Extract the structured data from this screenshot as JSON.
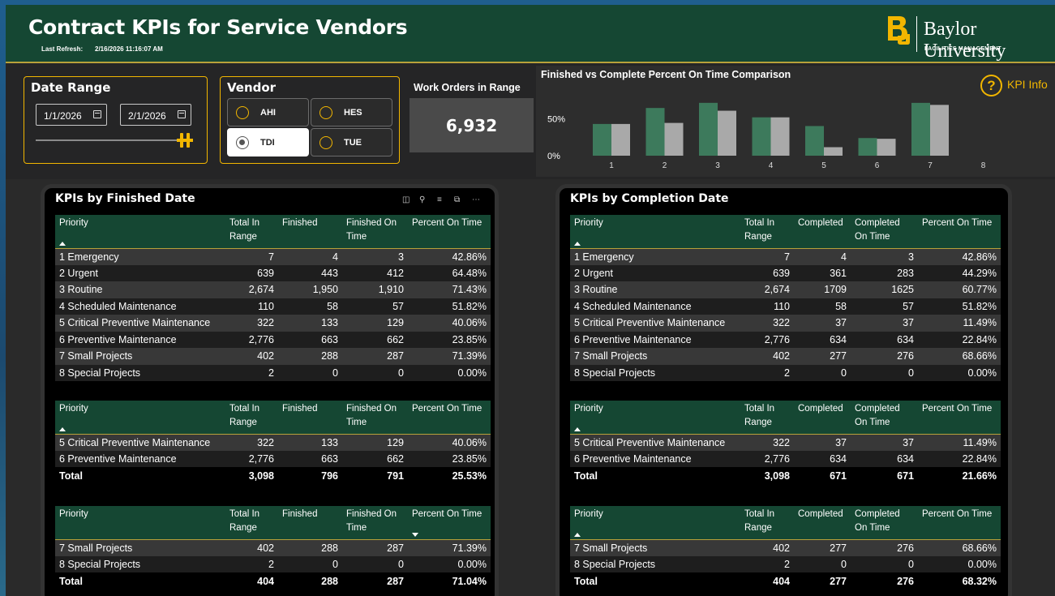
{
  "header": {
    "title": "Contract KPIs for Service Vendors",
    "refresh_label": "Last Refresh:",
    "refresh_value": "2/16/2026 11:16:07 AM",
    "logo_name": "Baylor University",
    "logo_sub": "FACILITIES MANAGEMENT"
  },
  "date_range": {
    "title": "Date Range",
    "start": "1/1/2026",
    "end": "2/1/2026"
  },
  "vendor": {
    "title": "Vendor",
    "options": [
      {
        "label": "AHI",
        "selected": false
      },
      {
        "label": "HES",
        "selected": false
      },
      {
        "label": "TDI",
        "selected": true
      },
      {
        "label": "TUE",
        "selected": false
      }
    ]
  },
  "work_orders": {
    "title": "Work Orders in Range",
    "value": "6,932"
  },
  "kpi_info": {
    "icon": "question-circle-icon",
    "label": "KPI Info"
  },
  "colors": {
    "accent": "#f2b600",
    "brand_green": "#154733",
    "bar_green": "#3d7a5c",
    "bar_gray": "#a9a9a9"
  },
  "chart_data": {
    "type": "bar",
    "title": "Finished vs Complete Percent On Time Comparison",
    "categories": [
      "1",
      "2",
      "3",
      "4",
      "5",
      "6",
      "7",
      "8"
    ],
    "series": [
      {
        "values": [
          42.86,
          64.48,
          71.43,
          51.82,
          40.06,
          23.85,
          71.39,
          0.0
        ]
      },
      {
        "values": [
          42.86,
          44.29,
          60.77,
          51.82,
          11.49,
          22.84,
          68.66,
          0.0
        ]
      }
    ],
    "yticks": [
      "50%",
      "0%"
    ],
    "ylim": [
      0,
      80
    ]
  },
  "left": {
    "title": "KPIs by Finished Date",
    "headers": [
      "Priority",
      "Total In Range",
      "Finished",
      "Finished On Time",
      "Percent On Time"
    ],
    "table1": [
      [
        "1 Emergency",
        "7",
        "4",
        "3",
        "42.86%"
      ],
      [
        "2 Urgent",
        "639",
        "443",
        "412",
        "64.48%"
      ],
      [
        "3 Routine",
        "2,674",
        "1,950",
        "1,910",
        "71.43%"
      ],
      [
        "4 Scheduled Maintenance",
        "110",
        "58",
        "57",
        "51.82%"
      ],
      [
        "5 Critical Preventive Maintenance",
        "322",
        "133",
        "129",
        "40.06%"
      ],
      [
        "6 Preventive Maintenance",
        "2,776",
        "663",
        "662",
        "23.85%"
      ],
      [
        "7 Small Projects",
        "402",
        "288",
        "287",
        "71.39%"
      ],
      [
        "8 Special Projects",
        "2",
        "0",
        "0",
        "0.00%"
      ]
    ],
    "table2": [
      [
        "5 Critical Preventive Maintenance",
        "322",
        "133",
        "129",
        "40.06%"
      ],
      [
        "6 Preventive Maintenance",
        "2,776",
        "663",
        "662",
        "23.85%"
      ]
    ],
    "table2_total": [
      "Total",
      "3,098",
      "796",
      "791",
      "25.53%"
    ],
    "table3": [
      [
        "7 Small Projects",
        "402",
        "288",
        "287",
        "71.39%"
      ],
      [
        "8 Special Projects",
        "2",
        "0",
        "0",
        "0.00%"
      ]
    ],
    "table3_total": [
      "Total",
      "404",
      "288",
      "287",
      "71.04%"
    ]
  },
  "right": {
    "title": "KPIs by Completion Date",
    "headers": [
      "Priority",
      "Total In Range",
      "Completed",
      "Completed On Time",
      "Percent On Time"
    ],
    "table1": [
      [
        "1 Emergency",
        "7",
        "4",
        "3",
        "42.86%"
      ],
      [
        "2 Urgent",
        "639",
        "361",
        "283",
        "44.29%"
      ],
      [
        "3 Routine",
        "2,674",
        "1709",
        "1625",
        "60.77%"
      ],
      [
        "4 Scheduled Maintenance",
        "110",
        "58",
        "57",
        "51.82%"
      ],
      [
        "5 Critical Preventive Maintenance",
        "322",
        "37",
        "37",
        "11.49%"
      ],
      [
        "6 Preventive Maintenance",
        "2,776",
        "634",
        "634",
        "22.84%"
      ],
      [
        "7 Small Projects",
        "402",
        "277",
        "276",
        "68.66%"
      ],
      [
        "8 Special Projects",
        "2",
        "0",
        "0",
        "0.00%"
      ]
    ],
    "table2": [
      [
        "5 Critical Preventive Maintenance",
        "322",
        "37",
        "37",
        "11.49%"
      ],
      [
        "6 Preventive Maintenance",
        "2,776",
        "634",
        "634",
        "22.84%"
      ]
    ],
    "table2_total": [
      "Total",
      "3,098",
      "671",
      "671",
      "21.66%"
    ],
    "table3": [
      [
        "7 Small Projects",
        "402",
        "277",
        "276",
        "68.66%"
      ],
      [
        "8 Special Projects",
        "2",
        "0",
        "0",
        "0.00%"
      ]
    ],
    "table3_total": [
      "Total",
      "404",
      "277",
      "276",
      "68.32%"
    ]
  }
}
